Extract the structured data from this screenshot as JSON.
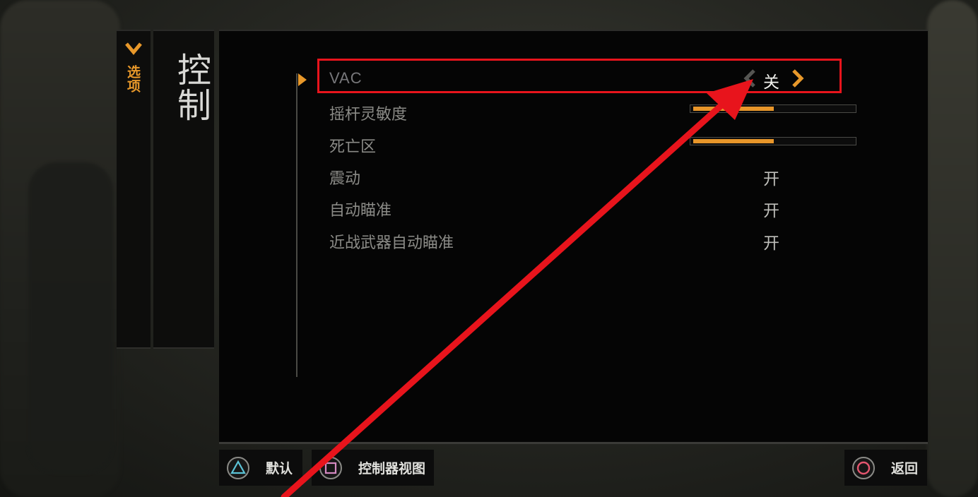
{
  "sidebar": {
    "back_label": "选项",
    "page_title": "控制"
  },
  "settings": [
    {
      "label": "VAC",
      "type": "toggle",
      "value": "关",
      "selected": true
    },
    {
      "label": "摇杆灵敏度",
      "type": "slider",
      "level": 0.5
    },
    {
      "label": "死亡区",
      "type": "slider",
      "level": 0.5
    },
    {
      "label": "震动",
      "type": "toggle",
      "value": "开"
    },
    {
      "label": "自动瞄准",
      "type": "toggle",
      "value": "开"
    },
    {
      "label": "近战武器自动瞄准",
      "type": "toggle",
      "value": "开"
    }
  ],
  "footer": {
    "default_label": "默认",
    "default_icon": "triangle-button-icon",
    "controller_view_label": "控制器视图",
    "controller_view_icon": "square-button-icon",
    "back_label": "返回",
    "back_icon": "circle-button-icon"
  },
  "colors": {
    "accent": "#e8982a",
    "highlight": "#e8141c",
    "panel": "#050505"
  }
}
